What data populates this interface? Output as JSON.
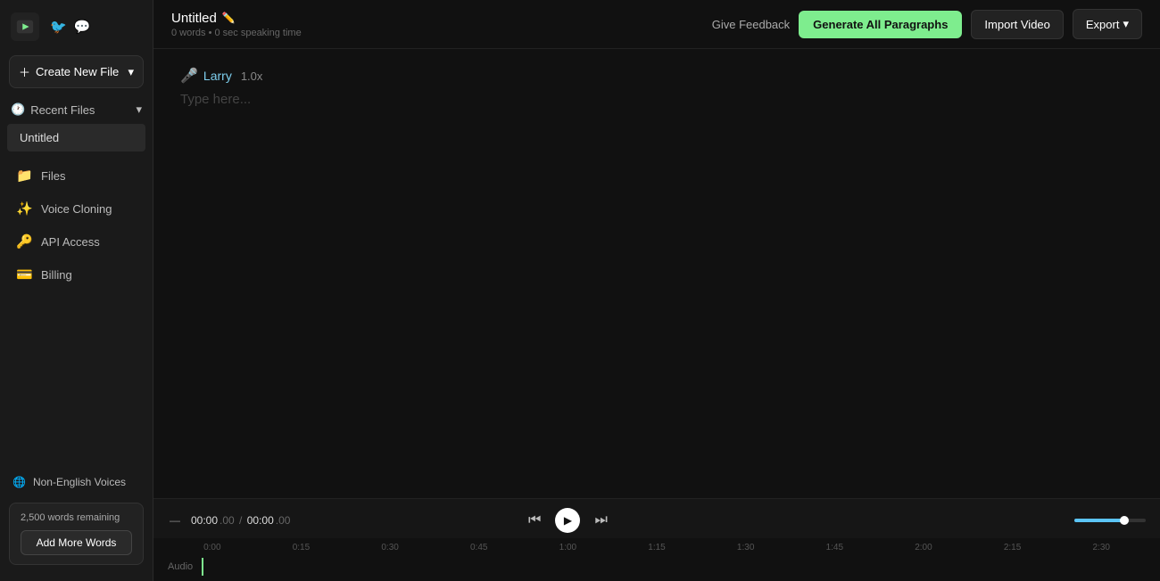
{
  "sidebar": {
    "logo_alt": "PlayHT Logo",
    "twitter_icon": "🐦",
    "discord_icon": "💬",
    "create_btn_label": "Create New File",
    "recent_files_label": "Recent Files",
    "recent_file_1": "Untitled",
    "nav_items": [
      {
        "id": "files",
        "icon": "📁",
        "label": "Files"
      },
      {
        "id": "voice-cloning",
        "icon": "✨",
        "label": "Voice Cloning"
      },
      {
        "id": "api-access",
        "icon": "🔑",
        "label": "API Access"
      },
      {
        "id": "billing",
        "icon": "💳",
        "label": "Billing"
      }
    ],
    "non_english_label": "Non-English Voices",
    "words_remaining": "2,500 words remaining",
    "add_words_label": "Add More Words"
  },
  "topbar": {
    "title": "Untitled",
    "subtitle": "0 words • 0 sec speaking time",
    "feedback_label": "Give Feedback",
    "generate_label": "Generate All Paragraphs",
    "import_label": "Import Video",
    "export_label": "Export"
  },
  "editor": {
    "voice_name": "Larry",
    "speed": "1.0x",
    "placeholder": "Type here..."
  },
  "player": {
    "dash": "—",
    "time_current_main": "00:00",
    "time_current_sub": ".00",
    "time_total_main": "00:00",
    "time_total_sub": ".00",
    "audio_label": "Audio"
  },
  "timeline": {
    "marks": [
      "0:00",
      "0:15",
      "0:30",
      "0:45",
      "1:00",
      "1:15",
      "1:30",
      "1:45",
      "2:00",
      "2:15",
      "2:30"
    ]
  },
  "colors": {
    "accent_green": "#7eed8e",
    "accent_blue": "#5bc4f5",
    "voice_blue": "#7ecfee"
  }
}
